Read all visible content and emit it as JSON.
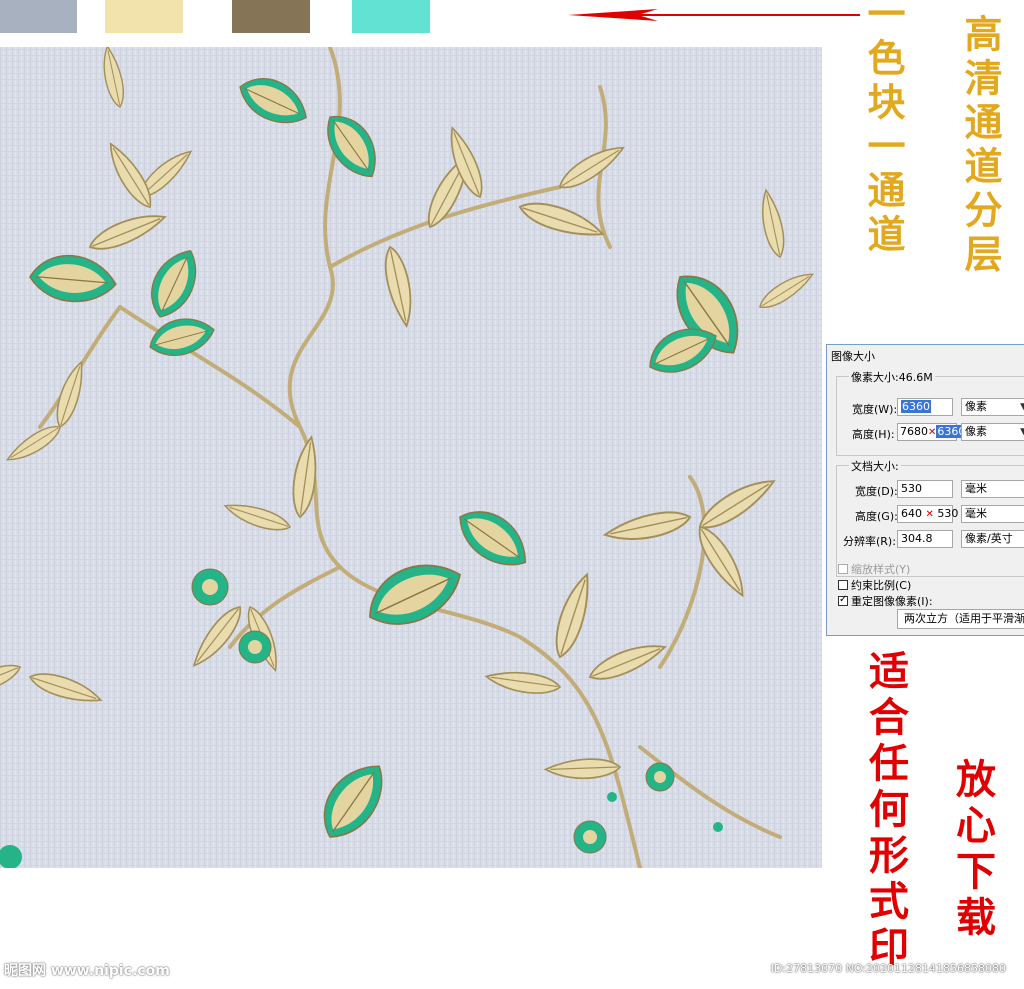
{
  "swatches": [
    {
      "name": "swatch-gray-blue",
      "color": "#a7b1bf"
    },
    {
      "name": "swatch-cream",
      "color": "#f2e3ad"
    },
    {
      "name": "swatch-olive-brown",
      "color": "#857556"
    },
    {
      "name": "swatch-turquoise",
      "color": "#62e2d2"
    }
  ],
  "colors": {
    "background": "#d8dde8",
    "leaf_light": "#e9dcae",
    "leaf_dark": "#a48f5b",
    "accent_green": "#24b487",
    "arrow_red": "#e00000"
  },
  "side_text": {
    "left_column": "一色块一通道",
    "right_column": "高清通道分层",
    "bottom_left": "适合任何形式印",
    "bottom_right": "放心下载"
  },
  "dialog": {
    "title": "图像大小",
    "pixel_size_label": "像素大小:46.6M",
    "width_label": "宽度(W):",
    "width_value": "6360",
    "width_unit": "像素",
    "height_label": "高度(H):",
    "height_value_prefix": "7680",
    "height_value_selected": "6360",
    "height_unit": "像素",
    "document_size_label": "文档大小:",
    "doc_width_label": "宽度(D):",
    "doc_width_value": "530",
    "doc_width_unit": "毫米",
    "doc_height_label": "高度(G):",
    "doc_height_value_a": "640",
    "doc_height_value_b": "530",
    "doc_height_unit": "毫米",
    "resolution_label": "分辨率(R):",
    "resolution_value": "304.8",
    "resolution_unit": "像素/英寸",
    "scale_styles_label": "缩放样式(Y)",
    "constrain_label": "约束比例(C)",
    "resample_label": "重定图像像素(I):",
    "resample_value": "两次立方（适用于平滑渐变"
  },
  "watermark": {
    "left": "昵图网 www.nipic.com",
    "right": "ID:27813070 NO:20201128141856858080"
  }
}
